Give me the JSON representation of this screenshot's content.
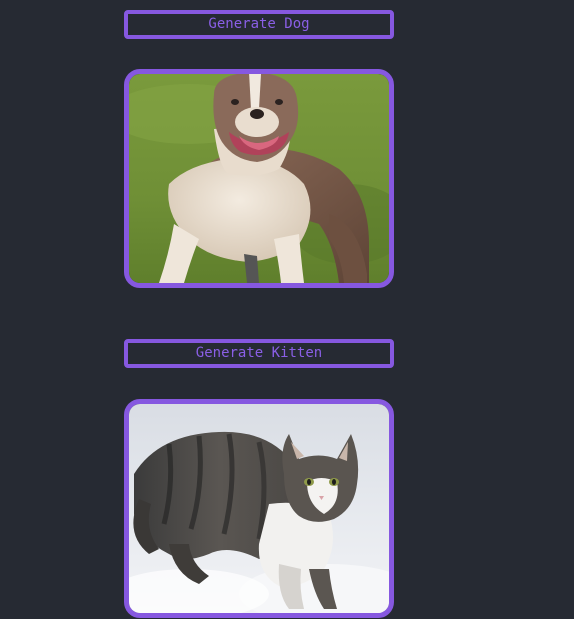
{
  "dog_section": {
    "button_label": "Generate Dog",
    "image": "dog-photo"
  },
  "kitten_section": {
    "button_label": "Generate Kitten",
    "image": "kitten-photo"
  },
  "colors": {
    "background": "#262a33",
    "accent": "#8658e0",
    "button_text": "#8a5fe6"
  }
}
